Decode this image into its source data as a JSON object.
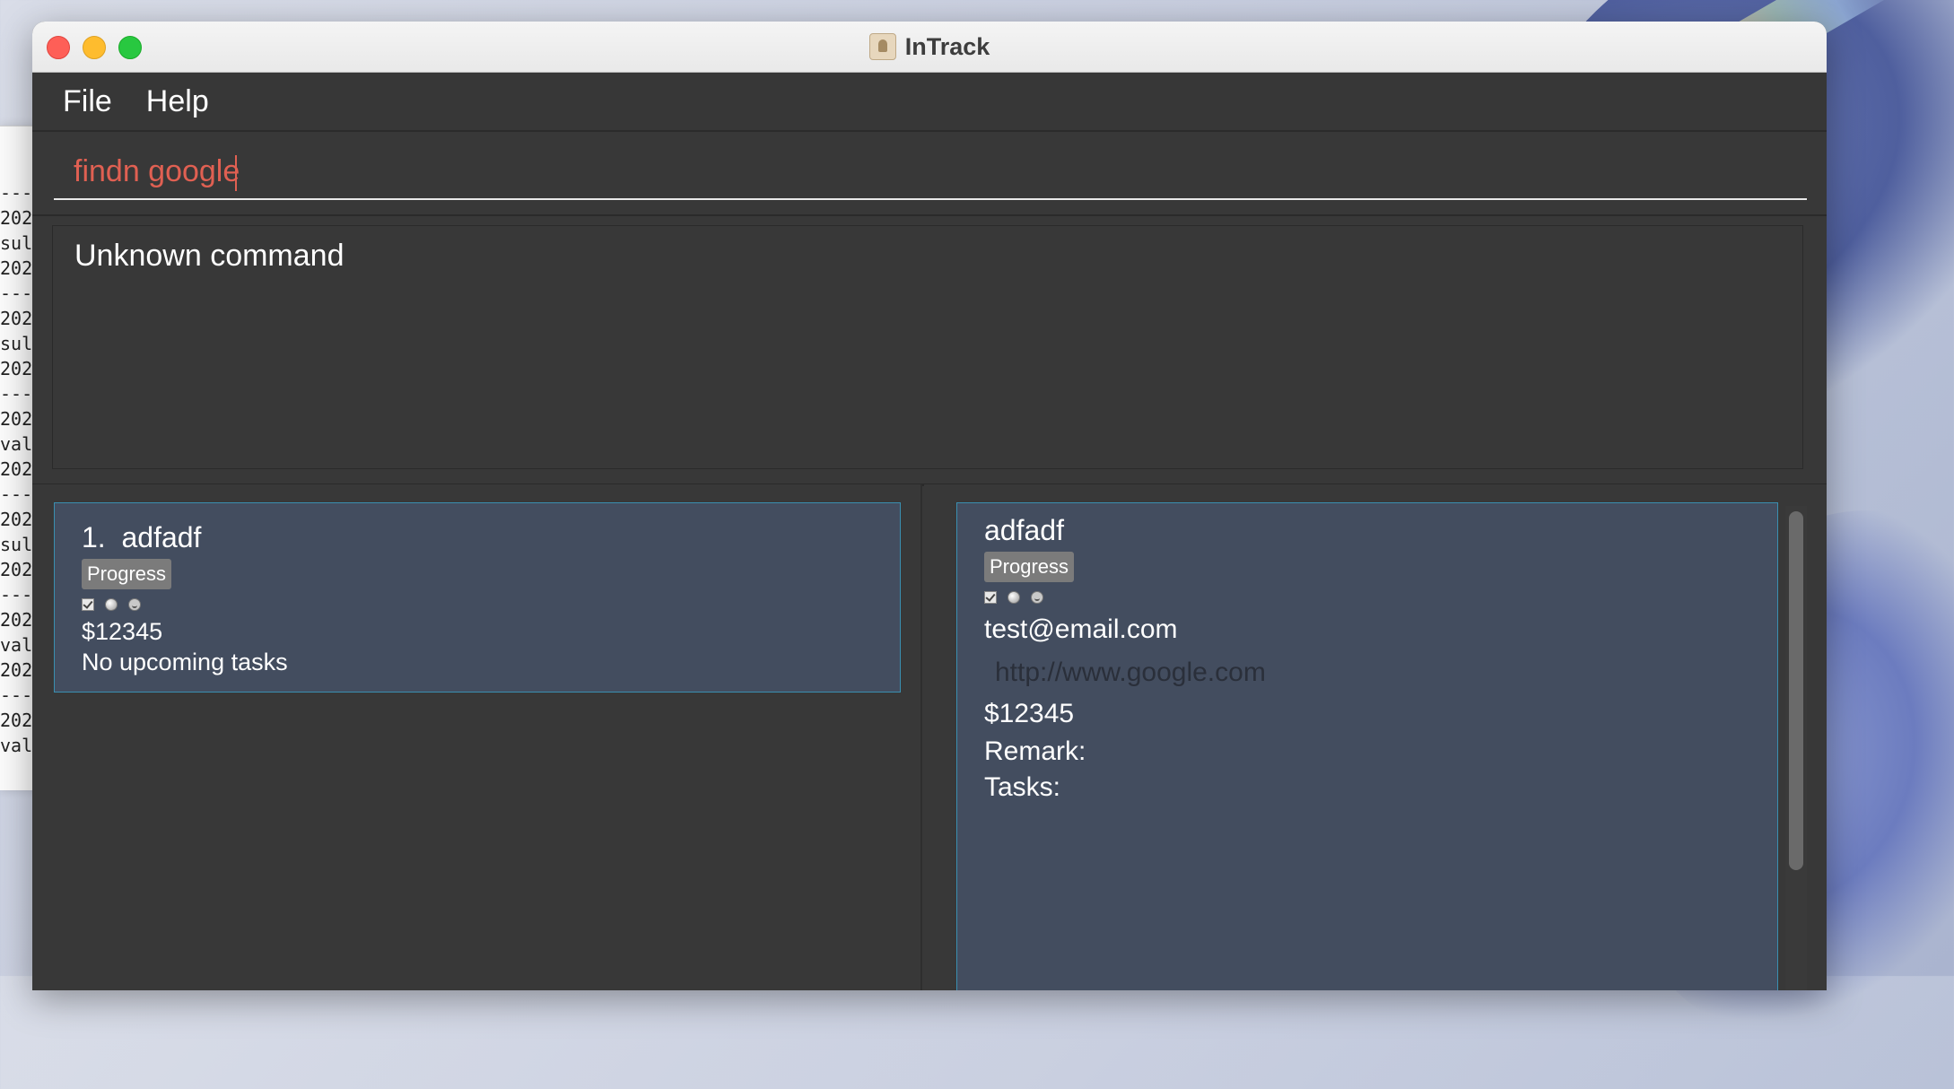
{
  "window": {
    "title": "InTrack"
  },
  "menu": {
    "items": [
      "File",
      "Help"
    ]
  },
  "command": {
    "value": "findn google"
  },
  "result": {
    "message": "Unknown command"
  },
  "terminal": {
    "lines": [
      "---",
      "202",
      "sul",
      "202",
      "---",
      "202",
      "sul",
      "202",
      "---",
      "202",
      "val",
      "202",
      "---",
      "202",
      "sul",
      "202",
      "---",
      "202",
      "val",
      "202",
      "---",
      "202",
      "val"
    ]
  },
  "list": {
    "cards": [
      {
        "index": "1.",
        "name": "adfadf",
        "tag": "Progress",
        "salary": "$12345",
        "tasks": "No upcoming tasks"
      }
    ]
  },
  "detail": {
    "name": "adfadf",
    "tag": "Progress",
    "email": "test@email.com",
    "website": "http://www.google.com",
    "salary": "$12345",
    "remark_label": "Remark:",
    "tasks_label": "Tasks:"
  },
  "colors": {
    "accent_border": "#3a8fb0",
    "command_text": "#e06052",
    "card_bg": "#434d5f",
    "tag_bg": "#7b7b7b"
  }
}
